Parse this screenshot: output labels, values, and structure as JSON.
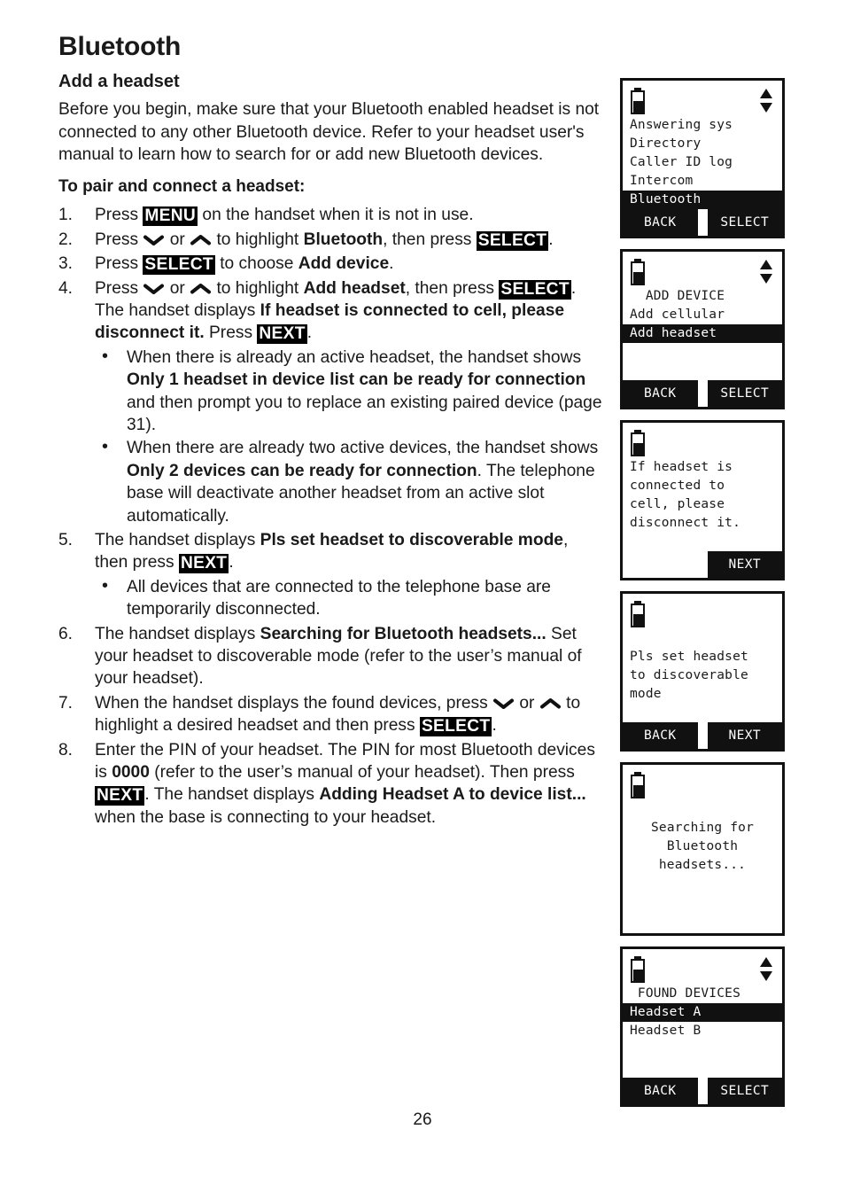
{
  "page": {
    "chapter_title": "Bluetooth",
    "section_title": "Add a headset",
    "intro": "Before you begin, make sure that your Bluetooth enabled headset is not connected to any other Bluetooth device. Refer to your headset user's manual to learn how to search for or add new Bluetooth devices.",
    "sub_title": "To pair and connect a headset:",
    "page_number": "26"
  },
  "steps": {
    "s1": {
      "num": "1.",
      "t1": "Press ",
      "key1": "MENU",
      "t2": " on the handset when it is not in use."
    },
    "s2": {
      "num": "2.",
      "t1": "Press ",
      "t2": " or ",
      "t3": " to highlight ",
      "b1": "Bluetooth",
      "t4": ", then press ",
      "key1": "SELECT",
      "t5": "."
    },
    "s3": {
      "num": "3.",
      "t1": "Press ",
      "key1": "SELECT",
      "t2": " to choose ",
      "b1": "Add device",
      "t3": "."
    },
    "s4": {
      "num": "4.",
      "t1": "Press ",
      "t2": " or ",
      "t3": " to highlight ",
      "b1": "Add headset",
      "t4": ", then press ",
      "key1": "SELECT",
      "t5": ". The handset displays ",
      "b2": "If headset is connected to cell, please disconnect it.",
      "t6": " Press ",
      "key2": "NEXT",
      "t7": "."
    },
    "s4_bullet1": {
      "t1": "When there is already an active headset, the handset shows ",
      "b1": "Only 1 headset in device list can be ready for connection",
      "t2": " and then prompt you to replace an existing paired device (page 31)."
    },
    "s4_bullet2": {
      "t1": "When there are already two active devices, the handset shows ",
      "b1": "Only 2 devices can be ready for connection",
      "t2": ". The telephone base will deactivate another headset from an active slot automatically."
    },
    "s5": {
      "num": "5.",
      "t1": "The handset displays ",
      "b1": "Pls set headset to discoverable mode",
      "t2": ", then press ",
      "key1": "NEXT",
      "t3": "."
    },
    "s5_bullet1": {
      "t1": "All devices that are connected to the telephone base are temporarily disconnected."
    },
    "s6": {
      "num": "6.",
      "t1": "The handset displays ",
      "b1": "Searching for Bluetooth headsets...",
      "t2": " Set your headset to discoverable mode (refer to the user’s manual of your headset)."
    },
    "s7": {
      "num": "7.",
      "t1": "When the handset displays the found devices, press ",
      "t2": " or ",
      "t3": " to highlight a desired headset and then press ",
      "key1": "SELECT",
      "t4": "."
    },
    "s8": {
      "num": "8.",
      "t1": "Enter the PIN of your headset. The PIN for most Bluetooth devices is ",
      "b1": "0000",
      "t2": " (refer to the user’s manual of your headset). Then press ",
      "key1": "NEXT",
      "t3": ". The handset displays ",
      "b2": "Adding Headset A to device list...",
      "t4": " when the base is connecting to your headset."
    }
  },
  "screens": [
    {
      "id": "main-menu",
      "has_scroll_arrows": true,
      "lines": [
        {
          "text": "Answering sys",
          "highlight": false,
          "center": false
        },
        {
          "text": "Directory",
          "highlight": false,
          "center": false
        },
        {
          "text": "Caller ID log",
          "highlight": false,
          "center": false
        },
        {
          "text": "Intercom",
          "highlight": false,
          "center": false
        },
        {
          "text": "Bluetooth",
          "highlight": true,
          "center": false
        }
      ],
      "softkeys": {
        "left": "BACK",
        "right": "SELECT"
      }
    },
    {
      "id": "add-device",
      "has_scroll_arrows": true,
      "lines": [
        {
          "text": "  ADD DEVICE",
          "highlight": false,
          "center": false
        },
        {
          "text": "Add cellular",
          "highlight": false,
          "center": false
        },
        {
          "text": "Add headset",
          "highlight": true,
          "center": false
        },
        {
          "text": "",
          "highlight": false,
          "center": false
        },
        {
          "text": "",
          "highlight": false,
          "center": false
        }
      ],
      "softkeys": {
        "left": "BACK",
        "right": "SELECT"
      }
    },
    {
      "id": "disconnect-cell-prompt",
      "has_scroll_arrows": false,
      "lines": [
        {
          "text": "If headset is",
          "highlight": false,
          "center": false
        },
        {
          "text": "connected to",
          "highlight": false,
          "center": false
        },
        {
          "text": "cell, please",
          "highlight": false,
          "center": false
        },
        {
          "text": "disconnect it.",
          "highlight": false,
          "center": false
        },
        {
          "text": "",
          "highlight": false,
          "center": false
        }
      ],
      "softkeys": {
        "left": "",
        "right": "NEXT"
      }
    },
    {
      "id": "discoverable-prompt",
      "has_scroll_arrows": false,
      "lines": [
        {
          "text": "",
          "highlight": false,
          "center": false
        },
        {
          "text": "Pls set headset",
          "highlight": false,
          "center": false
        },
        {
          "text": "to discoverable",
          "highlight": false,
          "center": false
        },
        {
          "text": "mode",
          "highlight": false,
          "center": false
        },
        {
          "text": "",
          "highlight": false,
          "center": false
        }
      ],
      "softkeys": {
        "left": "BACK",
        "right": "NEXT"
      }
    },
    {
      "id": "searching",
      "has_scroll_arrows": false,
      "lines": [
        {
          "text": "",
          "highlight": false,
          "center": true
        },
        {
          "text": "Searching for",
          "highlight": false,
          "center": true
        },
        {
          "text": "Bluetooth",
          "highlight": false,
          "center": true
        },
        {
          "text": "headsets...",
          "highlight": false,
          "center": true
        },
        {
          "text": "",
          "highlight": false,
          "center": true
        },
        {
          "text": "",
          "highlight": false,
          "center": true
        }
      ],
      "softkeys": null
    },
    {
      "id": "found-devices",
      "has_scroll_arrows": true,
      "lines": [
        {
          "text": " FOUND DEVICES",
          "highlight": false,
          "center": false
        },
        {
          "text": "Headset A",
          "highlight": true,
          "center": false
        },
        {
          "text": "Headset B",
          "highlight": false,
          "center": false
        },
        {
          "text": "",
          "highlight": false,
          "center": false
        },
        {
          "text": "",
          "highlight": false,
          "center": false
        }
      ],
      "softkeys": {
        "left": "BACK",
        "right": "SELECT"
      }
    }
  ]
}
